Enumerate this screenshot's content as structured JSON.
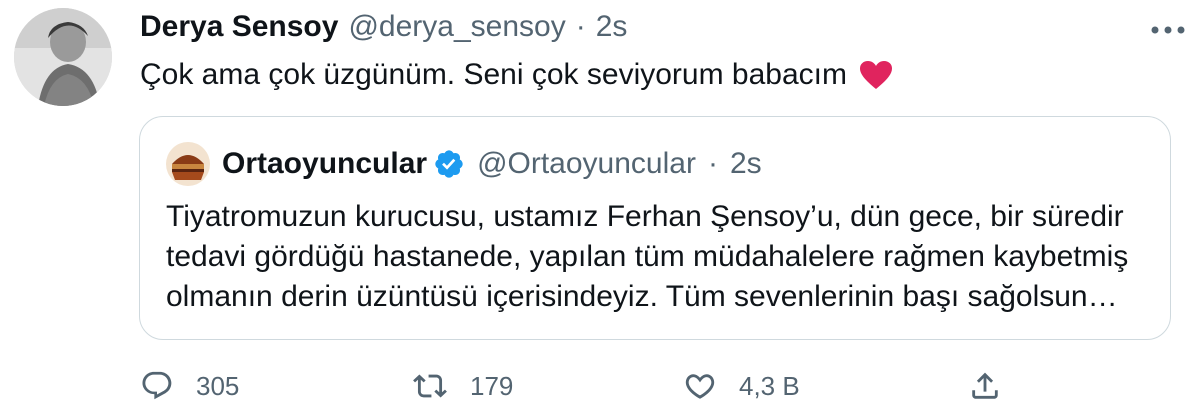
{
  "tweet": {
    "author_name": "Derya Sensoy",
    "author_handle": "@derya_sensoy",
    "separator": "·",
    "time": "2s",
    "text": "Çok ama çok üzgünüm. Seni çok seviyorum babacım",
    "emoji": "red-heart"
  },
  "quote": {
    "author_name": "Ortaoyuncular",
    "verified": true,
    "author_handle": "@Ortaoyuncular",
    "separator": "·",
    "time": "2s",
    "lines": [
      "Tiyatromuzun kurucusu, ustamız Ferhan Şensoy’u, dün gece, bir süredir",
      "tedavi gördüğü hastanede, yapılan tüm müdahalelere rağmen kaybetmiş",
      "olmanın derin üzüntüsü içerisindeyiz. Tüm sevenlerinin başı sağolsun…"
    ]
  },
  "actions": {
    "reply_count": "305",
    "retweet_count": "179",
    "like_count": "4,3 B"
  },
  "colors": {
    "text": "#0f1419",
    "secondary": "#536471",
    "border": "#cfd9de",
    "verified": "#1d9bf0",
    "heart": "#e0245e"
  },
  "icons": [
    "more-icon",
    "heart-emoji-icon",
    "verified-badge-icon",
    "reply-icon",
    "retweet-icon",
    "like-icon",
    "share-icon"
  ]
}
